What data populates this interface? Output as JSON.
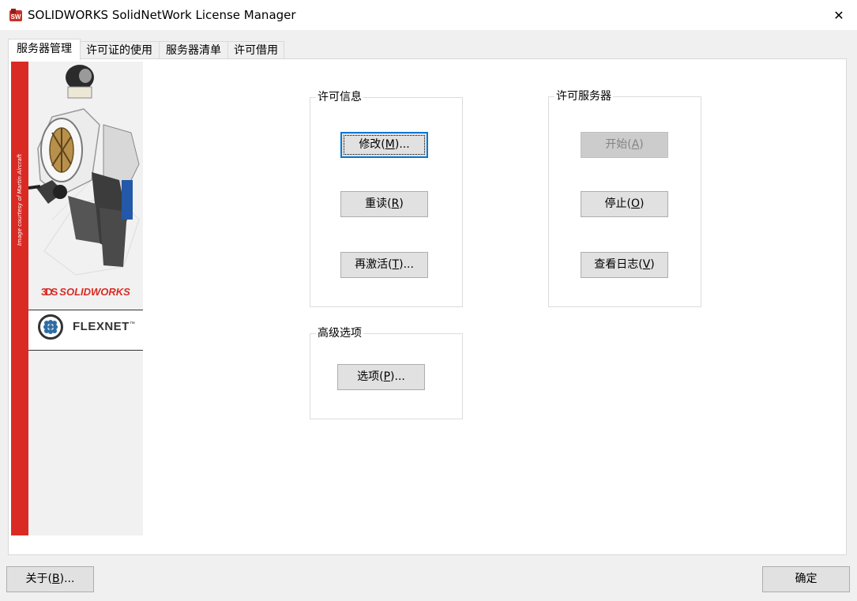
{
  "window": {
    "title": "SOLIDWORKS SolidNetWork License Manager",
    "close_glyph": "✕",
    "app_icon": "solidworks-app-icon"
  },
  "tabs": [
    {
      "label": "服务器管理",
      "active": true
    },
    {
      "label": "许可证的使用",
      "active": false
    },
    {
      "label": "服务器清单",
      "active": false
    },
    {
      "label": "许可借用",
      "active": false
    }
  ],
  "side_graphic": {
    "credit": "Image courtesy of Martin Aircraft",
    "solidworks_logo": "SOLIDWORKS",
    "solidworks_mark": "3DS",
    "flexnet_logo": "FLEXNET",
    "flexnet_tm": "™"
  },
  "license_info": {
    "title": "许可信息",
    "modify": {
      "text": "修改(",
      "key": "M",
      "suffix": ")..."
    },
    "reread": {
      "text": "重读(",
      "key": "R",
      "suffix": ")"
    },
    "reactivate": {
      "text": "再激活(",
      "key": "T",
      "suffix": ")..."
    }
  },
  "license_server": {
    "title": "许可服务器",
    "start": {
      "text": "开始(",
      "key": "A",
      "suffix": ")"
    },
    "stop": {
      "text": "停止(",
      "key": "O",
      "suffix": ")"
    },
    "view_log": {
      "text": "查看日志(",
      "key": "V",
      "suffix": ")"
    }
  },
  "advanced": {
    "title": "高级选项",
    "options": {
      "text": "选项(",
      "key": "P",
      "suffix": ")..."
    }
  },
  "footer": {
    "about": {
      "text": "关于(",
      "key": "B",
      "suffix": ")..."
    },
    "ok": "确定"
  },
  "colors": {
    "accent": "#0078d7",
    "brand_red": "#d92b24"
  }
}
